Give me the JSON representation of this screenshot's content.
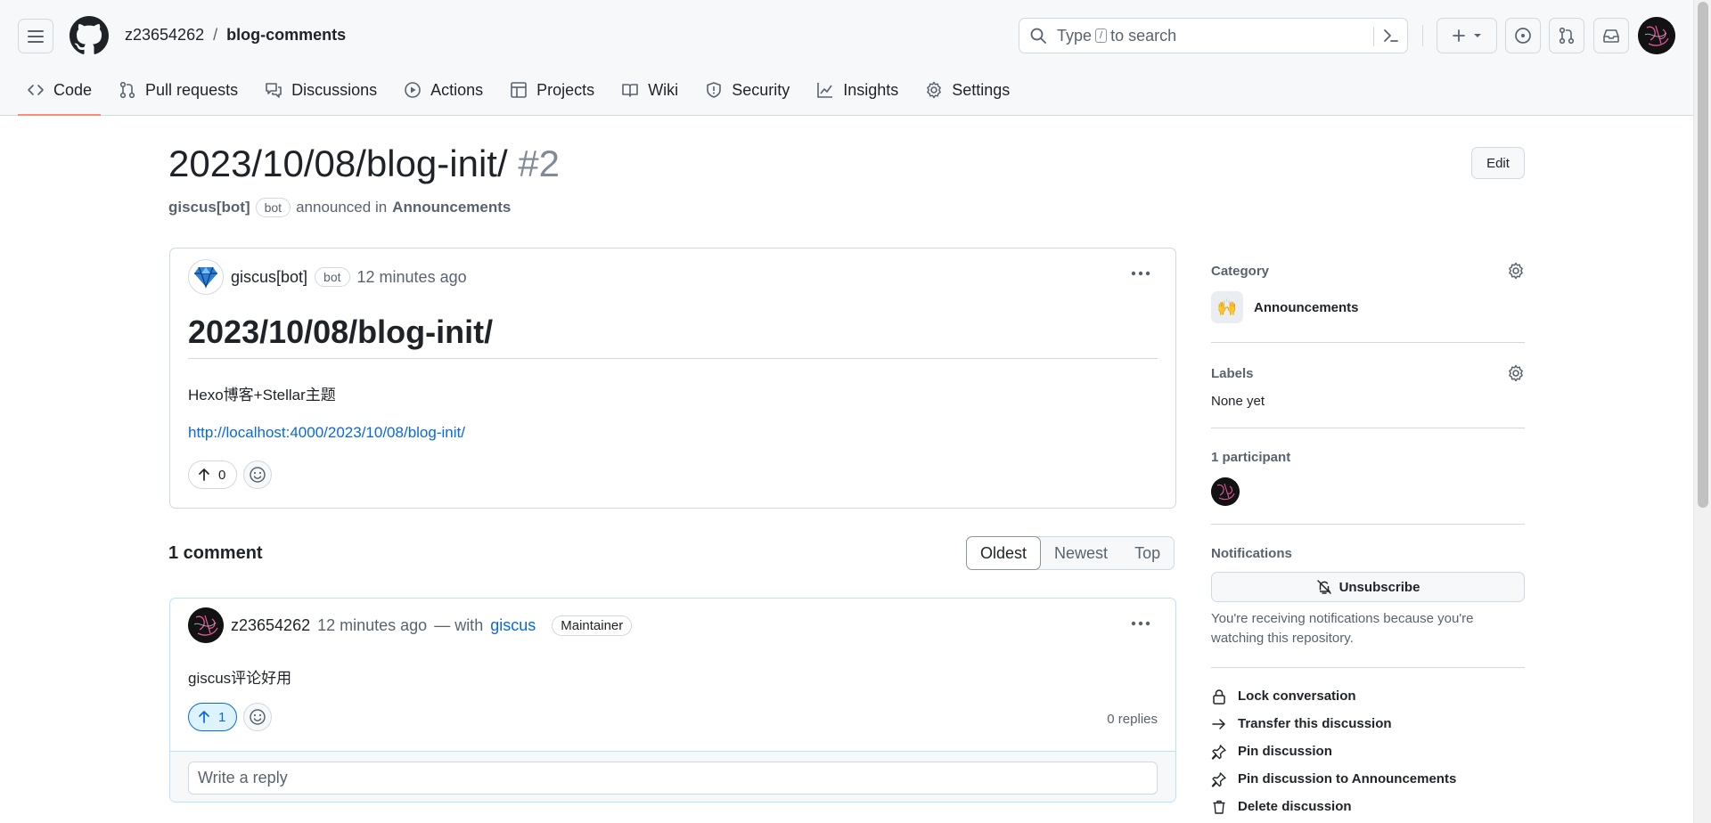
{
  "header": {
    "owner": "z23654262",
    "separator": "/",
    "repo": "blog-comments",
    "search_before": "Type",
    "search_key": "/",
    "search_after": "to search"
  },
  "tabs": [
    {
      "label": "Code",
      "icon": "code-icon",
      "active": true
    },
    {
      "label": "Pull requests",
      "icon": "pull-request-icon"
    },
    {
      "label": "Discussions",
      "icon": "discussions-icon"
    },
    {
      "label": "Actions",
      "icon": "play-icon"
    },
    {
      "label": "Projects",
      "icon": "table-icon"
    },
    {
      "label": "Wiki",
      "icon": "book-icon"
    },
    {
      "label": "Security",
      "icon": "shield-icon"
    },
    {
      "label": "Insights",
      "icon": "graph-icon"
    },
    {
      "label": "Settings",
      "icon": "gear-icon"
    }
  ],
  "discussion": {
    "title": "2023/10/08/blog-init/",
    "number": "#2",
    "edit_label": "Edit",
    "author": "giscus[bot]",
    "bot_label": "bot",
    "announced_in": "announced in",
    "category": "Announcements"
  },
  "post": {
    "author": "giscus[bot]",
    "bot_label": "bot",
    "time": "12 minutes ago",
    "heading": "2023/10/08/blog-init/",
    "body": "Hexo博客+Stellar主题",
    "link": "http://localhost:4000/2023/10/08/blog-init/",
    "upvotes": "0"
  },
  "comments": {
    "count_label": "1 comment",
    "sort": [
      {
        "label": "Oldest",
        "active": true
      },
      {
        "label": "Newest"
      },
      {
        "label": "Top"
      }
    ],
    "items": [
      {
        "author": "z23654262",
        "time": "12 minutes ago",
        "with_text": "— with",
        "via": "giscus",
        "badge": "Maintainer",
        "body": "giscus评论好用",
        "upvotes": "1",
        "replies": "0 replies",
        "reply_placeholder": "Write a reply"
      }
    ]
  },
  "sidebar": {
    "category_label": "Category",
    "category_name": "Announcements",
    "category_emoji": "🙌",
    "labels_label": "Labels",
    "labels_value": "None yet",
    "participants_label": "1 participant",
    "notifications_label": "Notifications",
    "unsubscribe_label": "Unsubscribe",
    "notification_note": "You're receiving notifications because you're watching this repository.",
    "actions": [
      {
        "label": "Lock conversation",
        "icon": "lock-icon"
      },
      {
        "label": "Transfer this discussion",
        "icon": "arrow-right-icon"
      },
      {
        "label": "Pin discussion",
        "icon": "pin-icon"
      },
      {
        "label": "Pin discussion to Announcements",
        "icon": "pin-icon"
      },
      {
        "label": "Delete discussion",
        "icon": "trash-icon"
      }
    ]
  },
  "colors": {
    "accent_link": "#0969da",
    "tab_underline": "#fd8c73",
    "border": "#d1d9e0",
    "comment_border": "#b6e3ff"
  }
}
